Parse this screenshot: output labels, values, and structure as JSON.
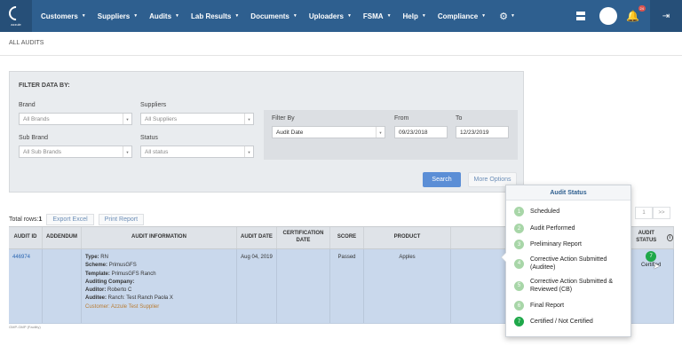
{
  "nav": {
    "logo_text": "azzule",
    "items": [
      {
        "label": "Customers"
      },
      {
        "label": "Suppliers"
      },
      {
        "label": "Audits"
      },
      {
        "label": "Lab Results"
      },
      {
        "label": "Documents"
      },
      {
        "label": "Uploaders"
      },
      {
        "label": "FSMA"
      },
      {
        "label": "Help"
      },
      {
        "label": "Compliance"
      }
    ],
    "notification_count": "24"
  },
  "breadcrumb": "ALL AUDITS",
  "filter": {
    "title": "FILTER DATA BY:",
    "brand_label": "Brand",
    "brand_value": "All Brands",
    "suppliers_label": "Suppliers",
    "suppliers_value": "All Suppliers",
    "sub_brand_label": "Sub Brand",
    "sub_brand_value": "All Sub Brands",
    "status_label": "Status",
    "status_value": "All status",
    "filter_by_label": "Filter By",
    "filter_by_value": "Audit Date",
    "from_label": "From",
    "from_value": "09/23/2018",
    "to_label": "To",
    "to_value": "12/23/2019",
    "search_label": "Search",
    "more_label": "More Options"
  },
  "toolbar": {
    "total_rows_label": "Total rows:",
    "total_rows_value": "1",
    "export_label": "Export Excel",
    "print_label": "Print Report"
  },
  "pager": {
    "page": "1",
    "next": ">>"
  },
  "table": {
    "headers": [
      "AUDIT ID",
      "ADDENDUM",
      "AUDIT INFORMATION",
      "AUDIT DATE",
      "CERTIFICATION DATE",
      "SCORE",
      "PRODUCT",
      "LOCATION",
      "AUDIT STATUS"
    ],
    "row": {
      "audit_id": "446974",
      "addendum": "",
      "type_label": "Type:",
      "type_value": "RN",
      "scheme_label": "Scheme:",
      "scheme_value": "PrimusGFS",
      "template_label": "Template:",
      "template_value": "PrimusGFS Ranch",
      "company_label": "Auditing Company:",
      "company_value": "",
      "auditor_label": "Auditor:",
      "auditor_value": "Roberto C",
      "auditee_label": "Auditee:",
      "auditee_value": "Ranch: Test Ranch Paola X",
      "customer_text": "Customer: Azzule Test Supplier",
      "audit_date": "Aug 04, 2019",
      "cert_date": "",
      "score": "Passed",
      "product": "Apples",
      "location_1": "Los Cab",
      "location_2": "Baja Califor",
      "location_3": "Mexico",
      "status_num": "7",
      "status_label": "Certified"
    }
  },
  "footer_text": "GMP-GMP (Facility)",
  "popover": {
    "title": "Audit Status",
    "items": [
      {
        "num": "1",
        "label": "Scheduled"
      },
      {
        "num": "2",
        "label": "Audit Performed"
      },
      {
        "num": "3",
        "label": "Preliminary Report"
      },
      {
        "num": "4",
        "label": "Corrective Action Submitted (Auditee)"
      },
      {
        "num": "5",
        "label": "Corrective Action Submitted & Reviewed (CB)"
      },
      {
        "num": "6",
        "label": "Final Report"
      },
      {
        "num": "7",
        "label": "Certified / Not Certified"
      }
    ]
  }
}
